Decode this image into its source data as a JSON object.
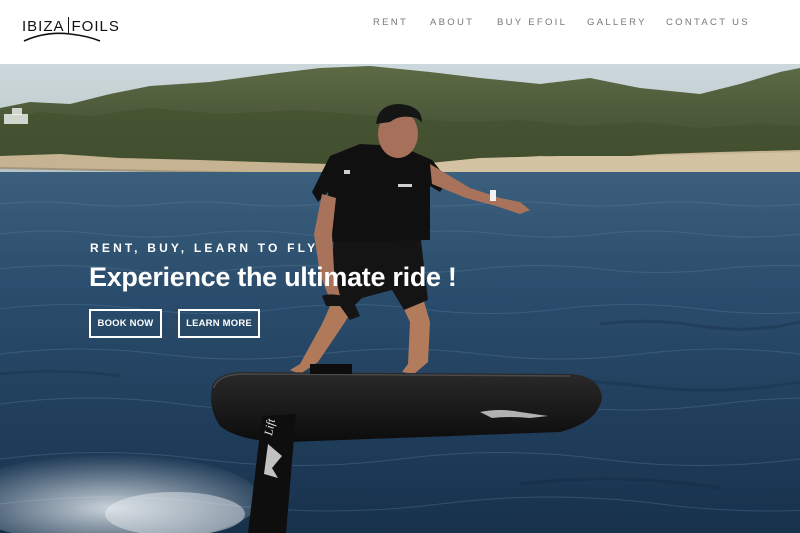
{
  "brand": {
    "logo_left": "IBIZA",
    "logo_right": "FOILS"
  },
  "nav": {
    "items": [
      {
        "label": "RENT"
      },
      {
        "label": "ABOUT"
      },
      {
        "label": "BUY EFOIL"
      },
      {
        "label": "GALLERY"
      },
      {
        "label": "CONTACT US"
      }
    ]
  },
  "hero": {
    "eyebrow": "RENT, BUY, LEARN TO FLY",
    "headline": "Experience the ultimate ride !",
    "buttons": {
      "book_now": "BOOK NOW",
      "learn_more": "LEARN MORE"
    },
    "board_brand": "Lift"
  },
  "colors": {
    "text_dark": "#111111",
    "nav_text": "#777777",
    "sea": "#24486a",
    "sky": "#c8d6dc",
    "hills": "#4d5e3c",
    "cliffs": "#c9b89a",
    "board": "#151515",
    "hero_text": "#ffffff"
  }
}
